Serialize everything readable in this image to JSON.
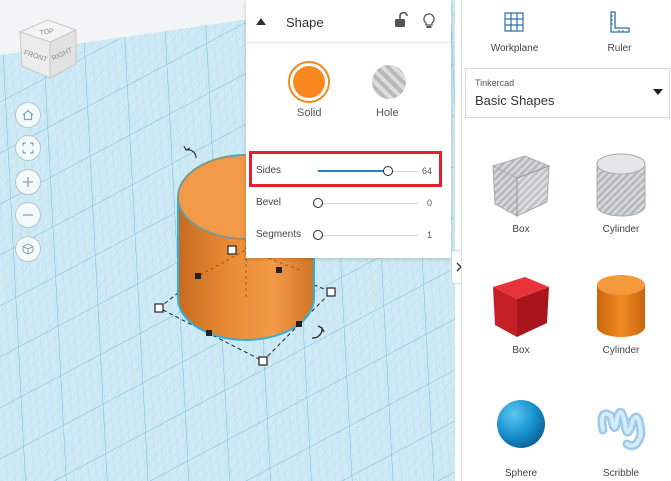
{
  "viewport": {
    "viewcube": {
      "top_label": "TOP",
      "front_label": "FRONT",
      "right_label": "RIGHT"
    },
    "nav_buttons": [
      {
        "icon": "home-icon"
      },
      {
        "icon": "fit-view-icon"
      },
      {
        "icon": "zoom-in-icon"
      },
      {
        "icon": "zoom-out-icon"
      },
      {
        "icon": "perspective-icon"
      }
    ],
    "grid_color": "#8ecfe6",
    "object_color": "#e88a34"
  },
  "shape_panel": {
    "title": "Shape",
    "solid_label": "Solid",
    "hole_label": "Hole",
    "solid_color": "#f7881f",
    "properties": [
      {
        "label": "Sides",
        "value": "64",
        "fraction": 0.85
      },
      {
        "label": "Bevel",
        "value": "0",
        "fraction": 0.0
      },
      {
        "label": "Segments",
        "value": "1",
        "fraction": 0.0
      }
    ],
    "highlight_color": "#e3202b"
  },
  "sidebar": {
    "workplane_label": "Workplane",
    "ruler_label": "Ruler",
    "library_source": "Tinkercad",
    "library_name": "Basic Shapes",
    "shapes": [
      {
        "label": "Box",
        "kind": "box-hole"
      },
      {
        "label": "Cylinder",
        "kind": "cylinder-hole"
      },
      {
        "label": "Box",
        "kind": "box-solid"
      },
      {
        "label": "Cylinder",
        "kind": "cylinder-solid"
      },
      {
        "label": "Sphere",
        "kind": "sphere"
      },
      {
        "label": "Scribble",
        "kind": "scribble"
      }
    ]
  }
}
